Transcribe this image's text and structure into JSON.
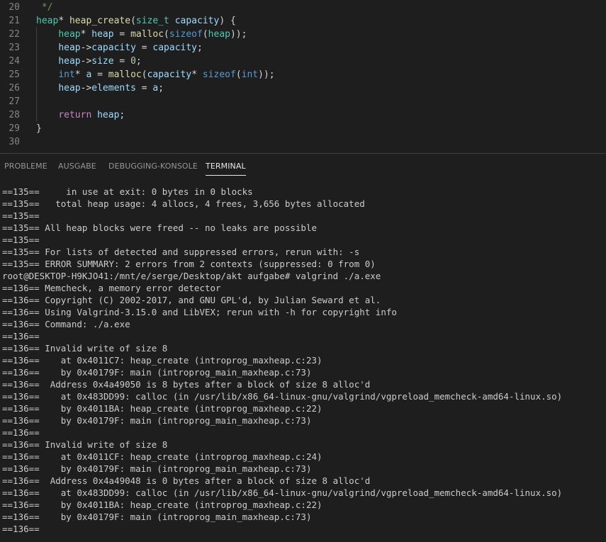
{
  "editor": {
    "lines": [
      {
        "num": "20",
        "tokens": [
          {
            "t": " */",
            "c": "comment"
          }
        ]
      },
      {
        "num": "21",
        "tokens": [
          {
            "t": "heap",
            "c": "type"
          },
          {
            "t": "* ",
            "c": "plain"
          },
          {
            "t": "heap_create",
            "c": "func"
          },
          {
            "t": "(",
            "c": "plain"
          },
          {
            "t": "size_t",
            "c": "type"
          },
          {
            "t": " ",
            "c": "plain"
          },
          {
            "t": "capacity",
            "c": "var"
          },
          {
            "t": ") {",
            "c": "plain"
          }
        ]
      },
      {
        "num": "22",
        "tokens": [
          {
            "t": "    ",
            "c": "plain"
          },
          {
            "t": "heap",
            "c": "type"
          },
          {
            "t": "* ",
            "c": "plain"
          },
          {
            "t": "heap",
            "c": "var"
          },
          {
            "t": " = ",
            "c": "plain"
          },
          {
            "t": "malloc",
            "c": "func"
          },
          {
            "t": "(",
            "c": "plain"
          },
          {
            "t": "sizeof",
            "c": "kw"
          },
          {
            "t": "(",
            "c": "plain"
          },
          {
            "t": "heap",
            "c": "type"
          },
          {
            "t": "));",
            "c": "plain"
          }
        ]
      },
      {
        "num": "23",
        "tokens": [
          {
            "t": "    ",
            "c": "plain"
          },
          {
            "t": "heap",
            "c": "var"
          },
          {
            "t": "->",
            "c": "plain"
          },
          {
            "t": "capacity",
            "c": "var"
          },
          {
            "t": " = ",
            "c": "plain"
          },
          {
            "t": "capacity",
            "c": "var"
          },
          {
            "t": ";",
            "c": "plain"
          }
        ]
      },
      {
        "num": "24",
        "tokens": [
          {
            "t": "    ",
            "c": "plain"
          },
          {
            "t": "heap",
            "c": "var"
          },
          {
            "t": "->",
            "c": "plain"
          },
          {
            "t": "size",
            "c": "var"
          },
          {
            "t": " = ",
            "c": "plain"
          },
          {
            "t": "0",
            "c": "num"
          },
          {
            "t": ";",
            "c": "plain"
          }
        ]
      },
      {
        "num": "25",
        "tokens": [
          {
            "t": "    ",
            "c": "plain"
          },
          {
            "t": "int",
            "c": "kw"
          },
          {
            "t": "* ",
            "c": "plain"
          },
          {
            "t": "a",
            "c": "var"
          },
          {
            "t": " = ",
            "c": "plain"
          },
          {
            "t": "malloc",
            "c": "func"
          },
          {
            "t": "(",
            "c": "plain"
          },
          {
            "t": "capacity",
            "c": "var"
          },
          {
            "t": "* ",
            "c": "plain"
          },
          {
            "t": "sizeof",
            "c": "kw"
          },
          {
            "t": "(",
            "c": "plain"
          },
          {
            "t": "int",
            "c": "kw"
          },
          {
            "t": "));",
            "c": "plain"
          }
        ]
      },
      {
        "num": "26",
        "tokens": [
          {
            "t": "    ",
            "c": "plain"
          },
          {
            "t": "heap",
            "c": "var"
          },
          {
            "t": "->",
            "c": "plain"
          },
          {
            "t": "elements",
            "c": "var"
          },
          {
            "t": " = ",
            "c": "plain"
          },
          {
            "t": "a",
            "c": "var"
          },
          {
            "t": ";",
            "c": "plain"
          }
        ]
      },
      {
        "num": "27",
        "tokens": []
      },
      {
        "num": "28",
        "tokens": [
          {
            "t": "    ",
            "c": "plain"
          },
          {
            "t": "return",
            "c": "ctrl"
          },
          {
            "t": " ",
            "c": "plain"
          },
          {
            "t": "heap",
            "c": "var"
          },
          {
            "t": ";",
            "c": "plain"
          }
        ]
      },
      {
        "num": "29",
        "tokens": [
          {
            "t": "}",
            "c": "plain"
          }
        ]
      },
      {
        "num": "30",
        "tokens": []
      }
    ]
  },
  "panel": {
    "tabs": [
      {
        "label": "PROBLEME",
        "active": false
      },
      {
        "label": "AUSGABE",
        "active": false
      },
      {
        "label": "DEBUGGING-KONSOLE",
        "active": false
      },
      {
        "label": "TERMINAL",
        "active": true
      }
    ]
  },
  "terminal": {
    "lines": [
      "==135==     in use at exit: 0 bytes in 0 blocks",
      "==135==   total heap usage: 4 allocs, 4 frees, 3,656 bytes allocated",
      "==135==",
      "==135== All heap blocks were freed -- no leaks are possible",
      "==135==",
      "==135== For lists of detected and suppressed errors, rerun with: -s",
      "==135== ERROR SUMMARY: 2 errors from 2 contexts (suppressed: 0 from 0)",
      "root@DESKTOP-H9KJO41:/mnt/e/serge/Desktop/akt aufgabe# valgrind ./a.exe",
      "==136== Memcheck, a memory error detector",
      "==136== Copyright (C) 2002-2017, and GNU GPL'd, by Julian Seward et al.",
      "==136== Using Valgrind-3.15.0 and LibVEX; rerun with -h for copyright info",
      "==136== Command: ./a.exe",
      "==136==",
      "==136== Invalid write of size 8",
      "==136==    at 0x4011C7: heap_create (introprog_maxheap.c:23)",
      "==136==    by 0x40179F: main (introprog_main_maxheap.c:73)",
      "==136==  Address 0x4a49050 is 8 bytes after a block of size 8 alloc'd",
      "==136==    at 0x483DD99: calloc (in /usr/lib/x86_64-linux-gnu/valgrind/vgpreload_memcheck-amd64-linux.so)",
      "==136==    by 0x4011BA: heap_create (introprog_maxheap.c:22)",
      "==136==    by 0x40179F: main (introprog_main_maxheap.c:73)",
      "==136==",
      "==136== Invalid write of size 8",
      "==136==    at 0x4011CF: heap_create (introprog_maxheap.c:24)",
      "==136==    by 0x40179F: main (introprog_main_maxheap.c:73)",
      "==136==  Address 0x4a49048 is 0 bytes after a block of size 8 alloc'd",
      "==136==    at 0x483DD99: calloc (in /usr/lib/x86_64-linux-gnu/valgrind/vgpreload_memcheck-amd64-linux.so)",
      "==136==    by 0x4011BA: heap_create (introprog_maxheap.c:22)",
      "==136==    by 0x40179F: main (introprog_main_maxheap.c:73)",
      "==136=="
    ]
  }
}
